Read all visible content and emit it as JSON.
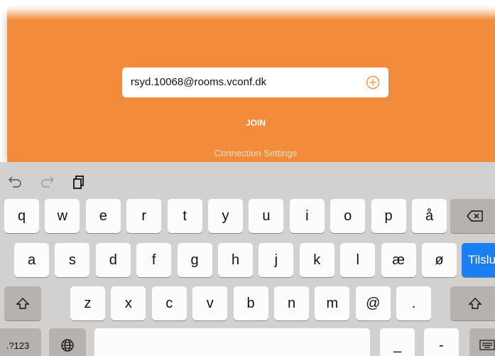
{
  "address_field": {
    "value": "rsyd.10068@rooms.vconf.dk",
    "add_icon": "plus-circle-icon"
  },
  "join_label": "JOIN",
  "connection_settings_label": "Connection Settings",
  "colors": {
    "accent": "#f28c3a",
    "keyboard_bg": "#d3d1d0",
    "return_key": "#1a7ef5"
  },
  "keyboard": {
    "toolbar_icons": [
      "undo-icon",
      "redo-icon",
      "paste-icon"
    ],
    "row1": [
      "q",
      "w",
      "e",
      "r",
      "t",
      "y",
      "u",
      "i",
      "o",
      "p",
      "å"
    ],
    "row2": [
      "a",
      "s",
      "d",
      "f",
      "g",
      "h",
      "j",
      "k",
      "l",
      "æ",
      "ø"
    ],
    "row3": [
      "z",
      "x",
      "c",
      "v",
      "b",
      "n",
      "m",
      "@",
      "."
    ],
    "return_label": "Tilslut",
    "numbers_label": ".?123",
    "underscore_label": "_",
    "dash_label": "-"
  }
}
